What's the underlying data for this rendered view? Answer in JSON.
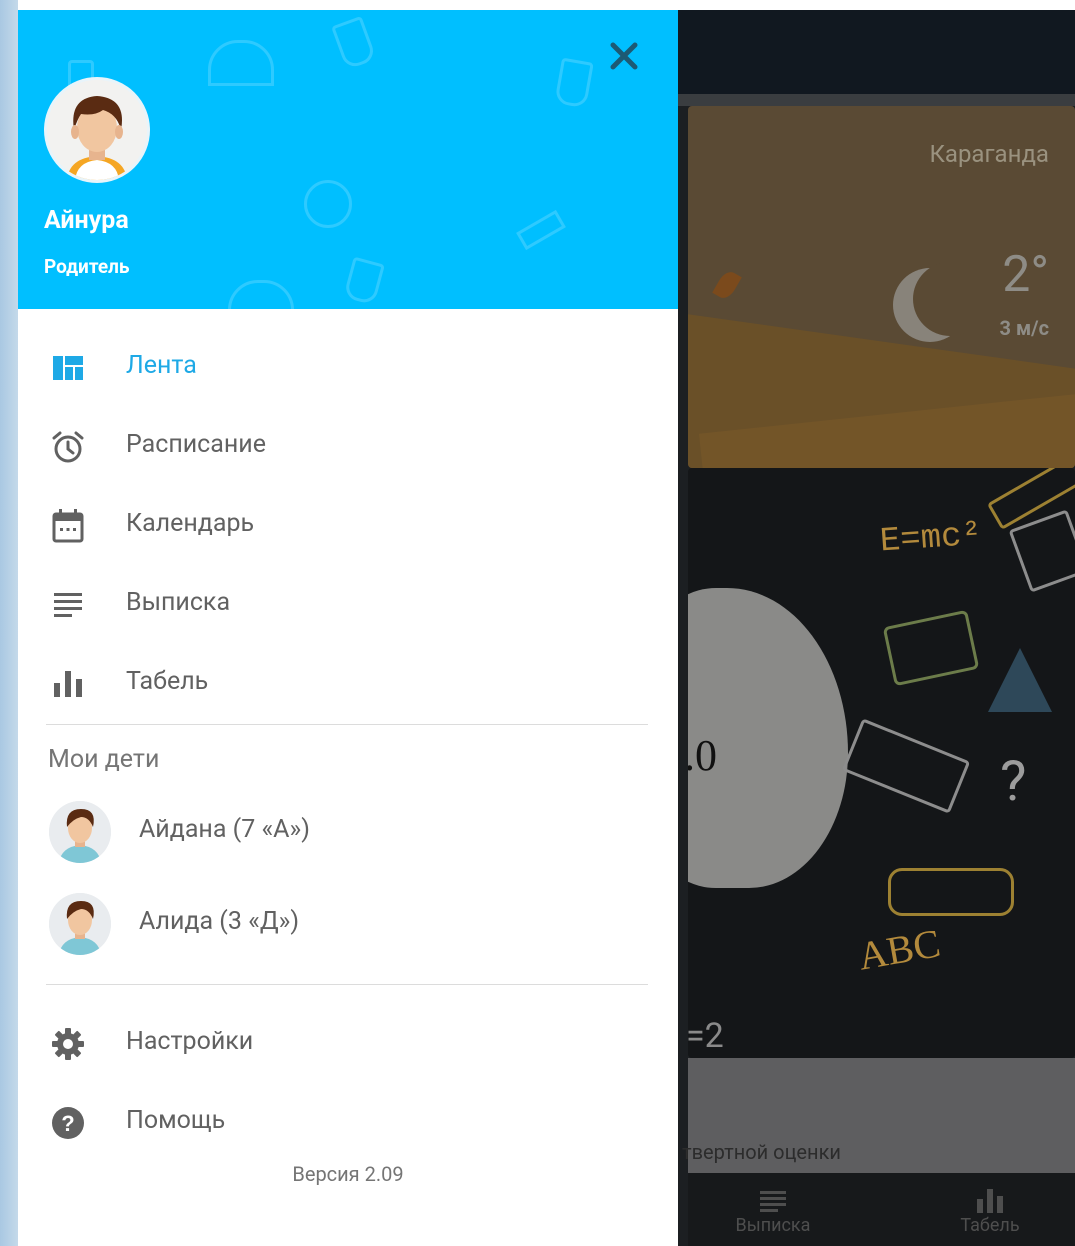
{
  "drawer": {
    "user": {
      "name": "Айнура",
      "role": "Родитель"
    },
    "menu": [
      {
        "label": "Лента",
        "icon": "dashboard-icon",
        "active": true
      },
      {
        "label": "Расписание",
        "icon": "alarm-clock-icon"
      },
      {
        "label": "Календарь",
        "icon": "calendar-icon"
      },
      {
        "label": "Выписка",
        "icon": "list-lines-icon"
      },
      {
        "label": "Табель",
        "icon": "bar-chart-icon"
      }
    ],
    "children_title": "Мои дети",
    "children": [
      {
        "label": "Айдана (7 «А»)"
      },
      {
        "label": "Алида (3 «Д»)"
      }
    ],
    "footer_menu": [
      {
        "label": "Настройки",
        "icon": "gear-icon"
      },
      {
        "label": "Помощь",
        "icon": "help-circle-icon"
      }
    ],
    "version": "Версия 2.09"
  },
  "background": {
    "weather": {
      "city": "Караганда",
      "temp": "2°",
      "wind": "3 м/с"
    },
    "doodle": {
      "number_fragment": ".0",
      "formula": "E=mc²",
      "abc": "ABC",
      "eq_fragment": "=2"
    },
    "card_caption": "твертной оценки",
    "tabbar": [
      {
        "label": "Выписка"
      },
      {
        "label": "Табель"
      }
    ]
  },
  "colors": {
    "header": "#00bfff",
    "active": "#1ea9e6",
    "text": "#616161",
    "overlay": "#1c1f22"
  }
}
